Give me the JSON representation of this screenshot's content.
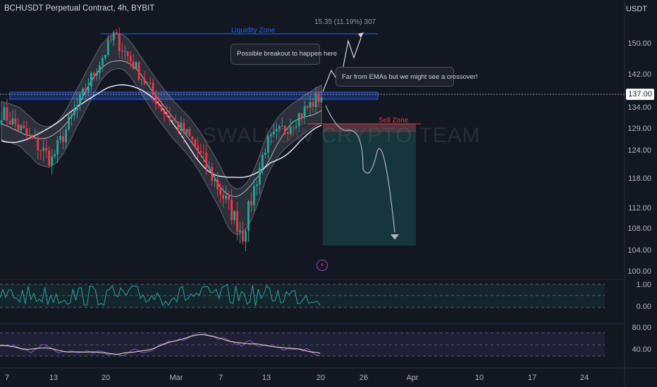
{
  "header": {
    "symbol": "BCHUSDT Perpetual Contract, 4h, BYBIT",
    "currency": "USDT"
  },
  "annotations": {
    "measure": "15.35 (11.19%) 307",
    "liquidity_zone": "Liquidity Zone",
    "sell_zone": "Sell Zone",
    "callout_breakout": "Possible breakout to happen here",
    "callout_emas": "Far from EMAs but we might see a crossover!",
    "watermark": "SWALLOW CRYPTO TEAM"
  },
  "price_axis": {
    "ticks": [
      "150.00",
      "142.00",
      "134.00",
      "129.00",
      "124.00",
      "118.00",
      "112.00",
      "108.00",
      "104.00",
      "100.00"
    ],
    "current_price": "137.00"
  },
  "indicator_axis": {
    "pane1_ticks": [
      "1.00",
      "0.00"
    ],
    "pane2_ticks": [
      "80.00",
      "40.00"
    ]
  },
  "time_axis": {
    "ticks": [
      "7",
      "13",
      "20",
      "Mar",
      "7",
      "13",
      "20",
      "26",
      "Apr",
      "10",
      "17",
      "24"
    ]
  },
  "colors": {
    "background": "#131722",
    "up": "#26a69a",
    "down": "#f23645",
    "liquidity": "#2962ff",
    "sell": "#f23645",
    "rsi": "#7e57c2",
    "osc": "#26a69a"
  },
  "chart_data": {
    "type": "candlestick",
    "symbol": "BCHUSDT",
    "timeframe": "4h",
    "current_price": 137,
    "price_range": [
      100,
      154
    ],
    "anchor_points": [
      {
        "label": "start",
        "close": 133
      },
      {
        "label": "low",
        "close": 122
      },
      {
        "label": "Feb 20 peak",
        "close": 152
      },
      {
        "label": "pullback",
        "close": 133
      },
      {
        "label": "drop",
        "close": 126
      },
      {
        "label": "Mar 10 low",
        "close": 107
      },
      {
        "label": "rebound",
        "close": 125
      },
      {
        "label": "recent",
        "close": 137
      }
    ],
    "levels": {
      "liquidity_zone": 151.5,
      "resistance_band": [
        136,
        138
      ],
      "sell_zone": 131.5,
      "short_target": 106
    },
    "indicator_ranges": {
      "pane1": [
        0,
        1
      ],
      "pane2": [
        40,
        80
      ]
    }
  }
}
